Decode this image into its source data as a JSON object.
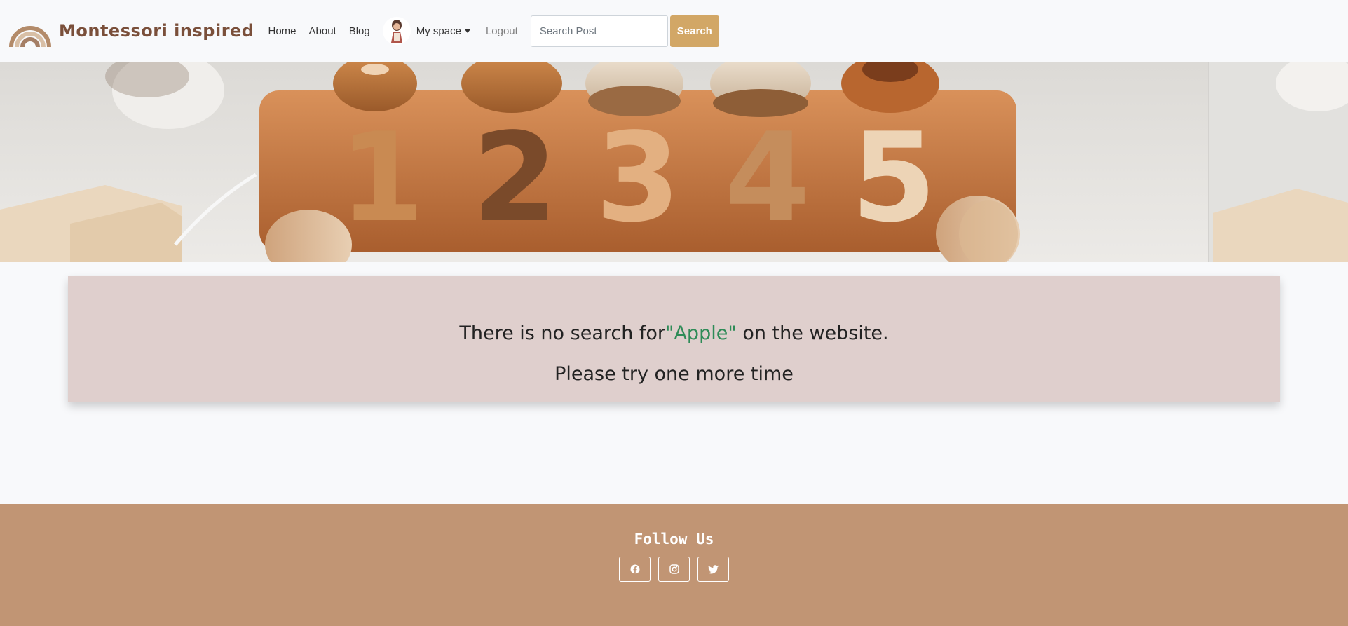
{
  "navbar": {
    "brand": "Montessori inspired",
    "links": {
      "home": "Home",
      "about": "About",
      "blog": "Blog"
    },
    "my_space": "My space",
    "logout": "Logout",
    "search": {
      "placeholder": "Search Post",
      "button": "Search"
    }
  },
  "hero": {
    "digits": [
      "1",
      "2",
      "3",
      "4",
      "5"
    ]
  },
  "message": {
    "prefix": "There is no search for",
    "term": "\"Apple\"",
    "suffix": " on the website.",
    "retry": "Please try one more time"
  },
  "footer": {
    "follow_title": "Follow Us",
    "social": [
      {
        "icon": "facebook-icon"
      },
      {
        "icon": "instagram-icon"
      },
      {
        "icon": "twitter-icon"
      }
    ]
  },
  "colors": {
    "accent": "#d2a766",
    "message_bg": "#dfcfcd",
    "search_term": "#2e8b57",
    "footer_bg": "#c19574",
    "brand_text": "#7a4f3a"
  }
}
